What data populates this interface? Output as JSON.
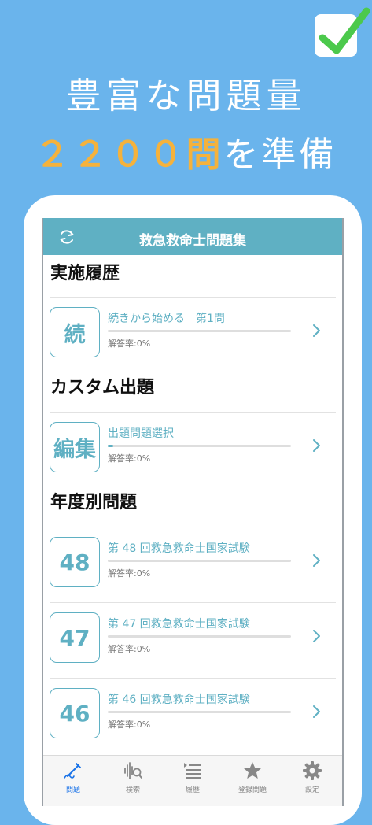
{
  "headline": {
    "line1": "豊富な問題量",
    "line2_number": "２２００問",
    "line2_rest": "を準備"
  },
  "nav": {
    "title": "救急救命士問題集"
  },
  "sections": [
    {
      "title": "実施履歴"
    },
    {
      "title": "カスタム出題"
    },
    {
      "title": "年度別問題"
    }
  ],
  "rows": [
    {
      "icon_text": "続",
      "title": "続きから始める　第1問",
      "rate": "解答率:0%",
      "progress": 0.0
    },
    {
      "icon_text": "編集",
      "title": "出題問題選択",
      "rate": "解答率:0%",
      "progress": 0.03
    },
    {
      "icon_text": "48",
      "title": "第 48 回救急救命士国家試験",
      "rate": "解答率:0%",
      "progress": 0.0
    },
    {
      "icon_text": "47",
      "title": "第 47 回救急救命士国家試験",
      "rate": "解答率:0%",
      "progress": 0.0
    },
    {
      "icon_text": "46",
      "title": "第 46 回救急救命士国家試験",
      "rate": "解答率:0%",
      "progress": 0.0
    }
  ],
  "tabs": [
    {
      "label": "問題",
      "icon": "pencil-icon",
      "active": true
    },
    {
      "label": "検索",
      "icon": "search-icon",
      "active": false
    },
    {
      "label": "履歴",
      "icon": "list-icon",
      "active": false
    },
    {
      "label": "登録問題",
      "icon": "star-icon",
      "active": false
    },
    {
      "label": "設定",
      "icon": "gear-icon",
      "active": false
    }
  ],
  "colors": {
    "background": "#6ab4ec",
    "accent": "#5fb0c3",
    "highlight": "#f5b23c",
    "check": "#4cc94c",
    "active_tab": "#1a73e8"
  }
}
